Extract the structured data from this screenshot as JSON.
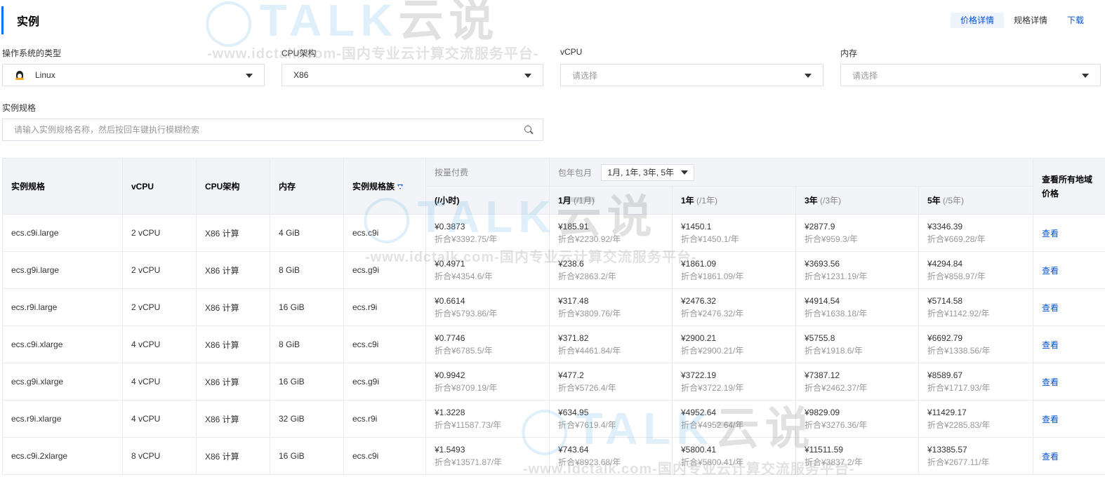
{
  "header": {
    "title": "实例",
    "links": [
      "价格详情",
      "规格详情",
      "下载"
    ]
  },
  "filters": {
    "os_type": {
      "label": "操作系统的类型",
      "value": "Linux",
      "icon": "linux-penguin-icon"
    },
    "cpu_arch": {
      "label": "CPU架构",
      "value": "X86"
    },
    "vcpu": {
      "label": "vCPU",
      "placeholder": "请选择"
    },
    "memory": {
      "label": "内存",
      "placeholder": "请选择"
    },
    "instance_spec": {
      "label": "实例规格",
      "placeholder": "请输入实例规格名称，然后按回车键执行模糊检索"
    }
  },
  "table": {
    "headers": {
      "spec": "实例规格",
      "vcpu": "vCPU",
      "cpu_arch": "CPU架构",
      "memory": "内存",
      "family": "实例规格族",
      "pay_as_you_go": "按量付费",
      "pay_as_you_go_unit": "(/小时)",
      "subscription": "包年包月",
      "term_select": "1月, 1年, 3年, 5年",
      "m1": "1月",
      "m1_unit": "(/1月)",
      "y1": "1年",
      "y1_unit": "(/1年)",
      "y3": "3年",
      "y3_unit": "(/3年)",
      "y5": "5年",
      "y5_unit": "(/5年)",
      "all_regions": "查看所有地域价格"
    },
    "rows": [
      {
        "spec": "ecs.c9i.large",
        "vcpu": "2 vCPU",
        "arch": "X86 计算",
        "mem": "4 GiB",
        "family": "ecs.c9i",
        "hourly": "¥0.3873",
        "hourly_sub": "折合¥3392.75/年",
        "m1": "¥185.91",
        "m1_sub": "折合¥2230.92/年",
        "y1": "¥1450.1",
        "y1_sub": "折合¥1450.1/年",
        "y3": "¥2877.9",
        "y3_sub": "折合¥959.3/年",
        "y5": "¥3346.39",
        "y5_sub": "折合¥669.28/年",
        "action": "查看"
      },
      {
        "spec": "ecs.g9i.large",
        "vcpu": "2 vCPU",
        "arch": "X86 计算",
        "mem": "8 GiB",
        "family": "ecs.g9i",
        "hourly": "¥0.4971",
        "hourly_sub": "折合¥4354.6/年",
        "m1": "¥238.6",
        "m1_sub": "折合¥2863.2/年",
        "y1": "¥1861.09",
        "y1_sub": "折合¥1861.09/年",
        "y3": "¥3693.56",
        "y3_sub": "折合¥1231.19/年",
        "y5": "¥4294.84",
        "y5_sub": "折合¥858.97/年",
        "action": "查看"
      },
      {
        "spec": "ecs.r9i.large",
        "vcpu": "2 vCPU",
        "arch": "X86 计算",
        "mem": "16 GiB",
        "family": "ecs.r9i",
        "hourly": "¥0.6614",
        "hourly_sub": "折合¥5793.86/年",
        "m1": "¥317.48",
        "m1_sub": "折合¥3809.76/年",
        "y1": "¥2476.32",
        "y1_sub": "折合¥2476.32/年",
        "y3": "¥4914.54",
        "y3_sub": "折合¥1638.18/年",
        "y5": "¥5714.58",
        "y5_sub": "折合¥1142.92/年",
        "action": "查看"
      },
      {
        "spec": "ecs.c9i.xlarge",
        "vcpu": "4 vCPU",
        "arch": "X86 计算",
        "mem": "8 GiB",
        "family": "ecs.c9i",
        "hourly": "¥0.7746",
        "hourly_sub": "折合¥6785.5/年",
        "m1": "¥371.82",
        "m1_sub": "折合¥4461.84/年",
        "y1": "¥2900.21",
        "y1_sub": "折合¥2900.21/年",
        "y3": "¥5755.8",
        "y3_sub": "折合¥1918.6/年",
        "y5": "¥6692.79",
        "y5_sub": "折合¥1338.56/年",
        "action": "查看"
      },
      {
        "spec": "ecs.g9i.xlarge",
        "vcpu": "4 vCPU",
        "arch": "X86 计算",
        "mem": "16 GiB",
        "family": "ecs.g9i",
        "hourly": "¥0.9942",
        "hourly_sub": "折合¥8709.19/年",
        "m1": "¥477.2",
        "m1_sub": "折合¥5726.4/年",
        "y1": "¥3722.19",
        "y1_sub": "折合¥3722.19/年",
        "y3": "¥7387.12",
        "y3_sub": "折合¥2462.37/年",
        "y5": "¥8589.67",
        "y5_sub": "折合¥1717.93/年",
        "action": "查看"
      },
      {
        "spec": "ecs.r9i.xlarge",
        "vcpu": "4 vCPU",
        "arch": "X86 计算",
        "mem": "32 GiB",
        "family": "ecs.r9i",
        "hourly": "¥1.3228",
        "hourly_sub": "折合¥11587.73/年",
        "m1": "¥634.95",
        "m1_sub": "折合¥7619.4/年",
        "y1": "¥4952.64",
        "y1_sub": "折合¥4952.64/年",
        "y3": "¥9829.09",
        "y3_sub": "折合¥3276.36/年",
        "y5": "¥11429.17",
        "y5_sub": "折合¥2285.83/年",
        "action": "查看"
      },
      {
        "spec": "ecs.c9i.2xlarge",
        "vcpu": "8 vCPU",
        "arch": "X86 计算",
        "mem": "16 GiB",
        "family": "ecs.c9i",
        "hourly": "¥1.5493",
        "hourly_sub": "折合¥13571.87/年",
        "m1": "¥743.64",
        "m1_sub": "折合¥8923.68/年",
        "y1": "¥5800.41",
        "y1_sub": "折合¥5800.41/年",
        "y3": "¥11511.59",
        "y3_sub": "折合¥3837.2/年",
        "y5": "¥13385.57",
        "y5_sub": "折合¥2677.11/年",
        "action": "查看"
      }
    ]
  },
  "watermark": {
    "text": "-www.idctalk.com-国内专业云计算交流服务平台-",
    "logo_main": "TALK",
    "logo_cn": "云说"
  },
  "colors": {
    "accent": "#006eff",
    "link": "#0052d9",
    "header_bg": "#f3f4f7"
  }
}
